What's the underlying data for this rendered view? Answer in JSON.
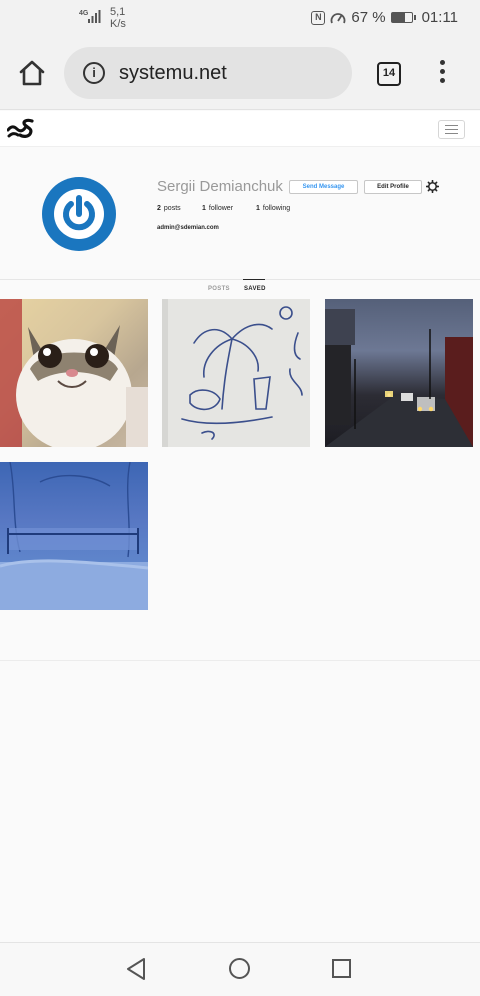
{
  "status_bar": {
    "network": "4G",
    "speed_value": "5,1",
    "speed_unit": "K/s",
    "battery": "67 %",
    "time": "01:11",
    "battery_level": 0.67
  },
  "browser": {
    "url": "systemu.net",
    "tab_count": "14"
  },
  "profile": {
    "username": "Sergii Demianchuk",
    "send_message_label": "Send Message",
    "edit_profile_label": "Edit Profile",
    "posts_count": "2",
    "posts_label": "posts",
    "followers_count": "1",
    "followers_label": "follower",
    "following_count": "1",
    "following_label": "following",
    "email": "admin@sdemian.com"
  },
  "tabs": {
    "posts": "POSTS",
    "saved": "SAVED",
    "active": "SAVED"
  },
  "saved_items": [
    {
      "subject": "smiling-cat-photo"
    },
    {
      "subject": "palm-tree-drawing-photo"
    },
    {
      "subject": "evening-street-photo"
    },
    {
      "subject": "snowy-yard-photo"
    }
  ],
  "colors": {
    "avatar_blue": "#1a76bf",
    "link_blue": "#3897f0"
  }
}
